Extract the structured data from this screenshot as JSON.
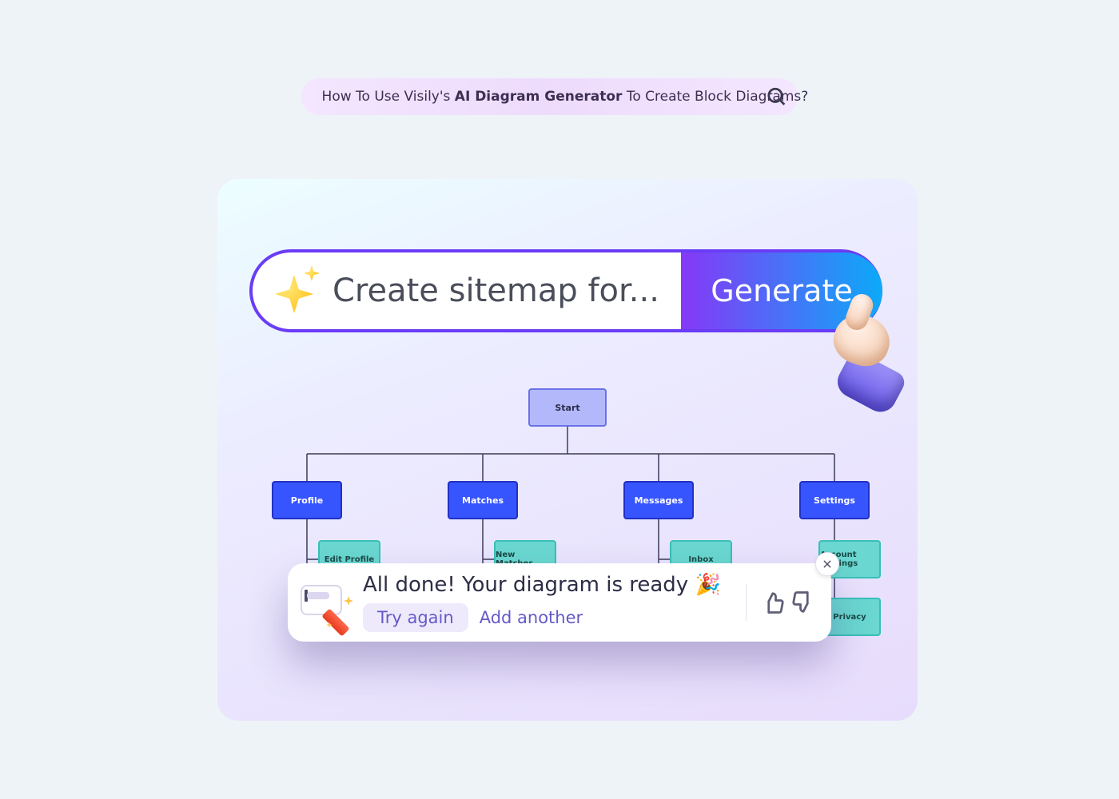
{
  "header": {
    "q_prefix": "How To Use Visily's ",
    "q_bold": "AI Diagram Generator",
    "q_suffix": " To Create Block Diagrams?"
  },
  "prompt": {
    "placeholder": "Create sitemap for...",
    "button": "Generate"
  },
  "tree": {
    "start": "Start",
    "mains": [
      "Profile",
      "Matches",
      "Messages",
      "Settings"
    ],
    "leaves": [
      [
        "Edit Profile",
        ""
      ],
      [
        "New Matches",
        ""
      ],
      [
        "Inbox",
        ""
      ],
      [
        "Account Settings",
        "Privacy"
      ]
    ]
  },
  "toast": {
    "title": "All done! Your diagram is ready 🎉",
    "try_again": "Try again",
    "add_another": "Add another"
  }
}
